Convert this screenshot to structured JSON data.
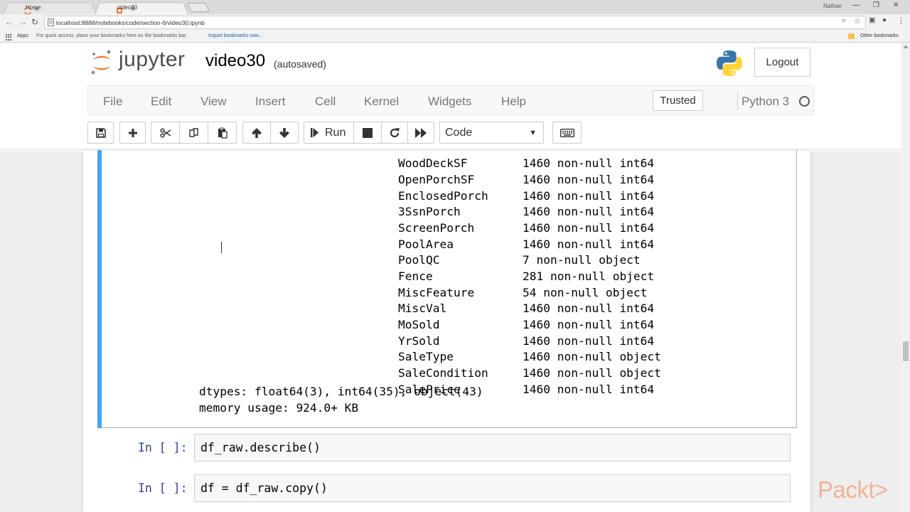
{
  "browser": {
    "tabs": [
      {
        "label": "Home",
        "active": false
      },
      {
        "label": "video30",
        "active": true
      }
    ],
    "profile_name": "Nathan",
    "url": "localhost:8888/notebooks/code/section-6/video30.ipynb",
    "bookmarks_bar": {
      "apps_label": "Apps",
      "hint": "For quick access, place your bookmarks here on the bookmarks bar.",
      "import_link": "Import bookmarks now...",
      "other_bookmarks": "Other bookmarks"
    }
  },
  "header": {
    "logo_text": "jupyter",
    "notebook_name": "video30",
    "save_status": "(autosaved)",
    "logout_label": "Logout"
  },
  "menubar": {
    "items": [
      "File",
      "Edit",
      "View",
      "Insert",
      "Cell",
      "Kernel",
      "Widgets",
      "Help"
    ],
    "trusted_label": "Trusted",
    "kernel_name": "Python 3"
  },
  "toolbar": {
    "run_label": "Run",
    "cell_type": "Code"
  },
  "output": {
    "rows": [
      {
        "name": "WoodDeckSF",
        "info": "1460 non-null int64"
      },
      {
        "name": "OpenPorchSF",
        "info": "1460 non-null int64"
      },
      {
        "name": "EnclosedPorch",
        "info": "1460 non-null int64"
      },
      {
        "name": "3SsnPorch",
        "info": "1460 non-null int64"
      },
      {
        "name": "ScreenPorch",
        "info": "1460 non-null int64"
      },
      {
        "name": "PoolArea",
        "info": "1460 non-null int64"
      },
      {
        "name": "PoolQC",
        "info": "7 non-null object"
      },
      {
        "name": "Fence",
        "info": "281 non-null object"
      },
      {
        "name": "MiscFeature",
        "info": "54 non-null object"
      },
      {
        "name": "MiscVal",
        "info": "1460 non-null int64"
      },
      {
        "name": "MoSold",
        "info": "1460 non-null int64"
      },
      {
        "name": "YrSold",
        "info": "1460 non-null int64"
      },
      {
        "name": "SaleType",
        "info": "1460 non-null object"
      },
      {
        "name": "SaleCondition",
        "info": "1460 non-null object"
      },
      {
        "name": "SalePrice",
        "info": "1460 non-null int64"
      }
    ],
    "dtypes_line": "dtypes: float64(3), int64(35), object(43)",
    "memory_line": "memory usage: 924.0+ KB"
  },
  "cells": [
    {
      "prompt": "In [ ]:",
      "code": "df_raw.describe()"
    },
    {
      "prompt": "In [ ]:",
      "code": "df = df_raw.copy()"
    }
  ],
  "watermark": "Packt>",
  "colors": {
    "selected_cell_bar": "#42a5f5",
    "prompt_blue": "#303f9f",
    "jupyter_orange": "#f37726"
  }
}
